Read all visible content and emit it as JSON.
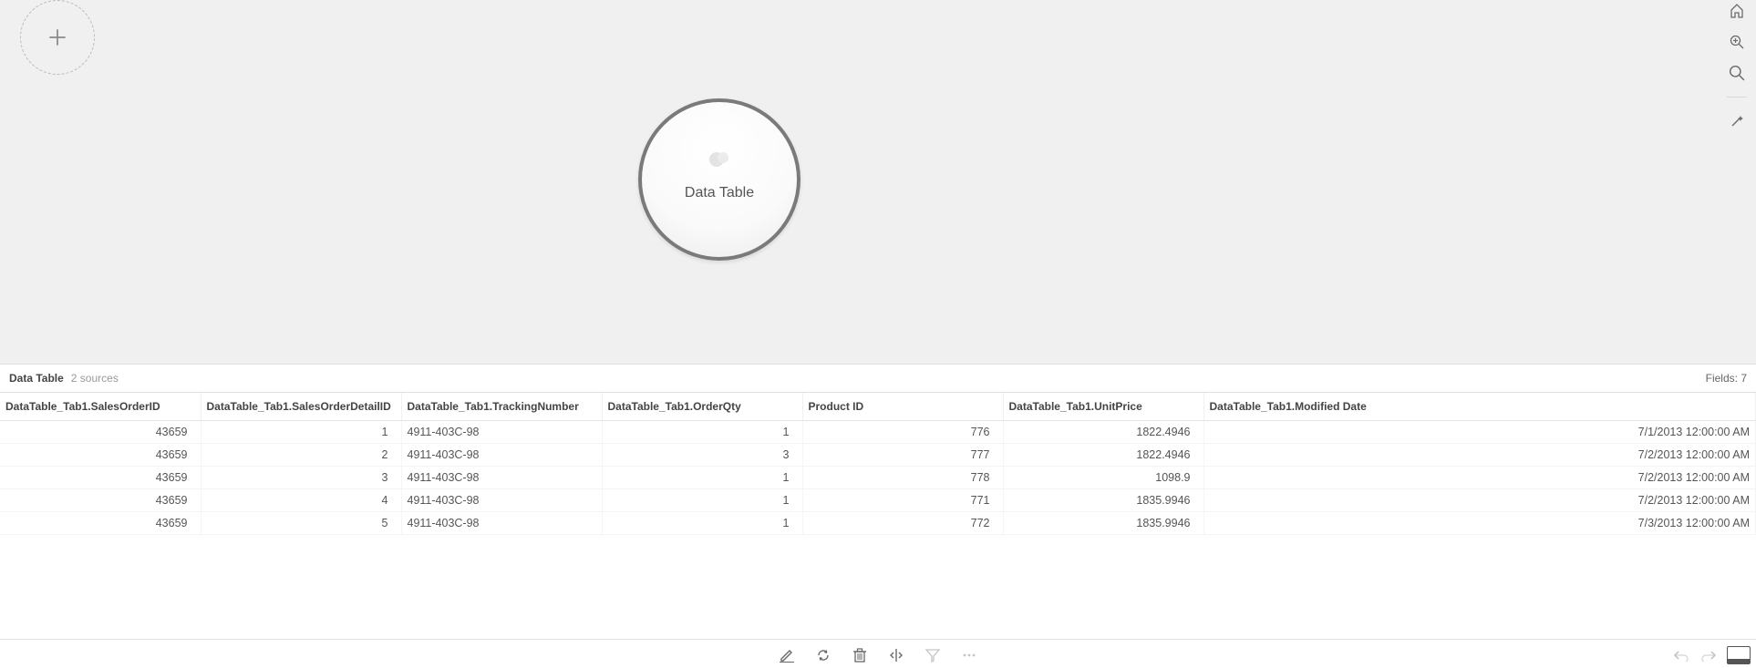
{
  "canvas": {
    "bubble_label": "Data Table"
  },
  "info": {
    "title": "Data Table",
    "sources": "2 sources",
    "fields": "Fields: 7"
  },
  "table": {
    "headers": [
      "DataTable_Tab1.SalesOrderID",
      "DataTable_Tab1.SalesOrderDetailID",
      "DataTable_Tab1.TrackingNumber",
      "DataTable_Tab1.OrderQty",
      "Product ID",
      "DataTable_Tab1.UnitPrice",
      "DataTable_Tab1.Modified Date"
    ],
    "rows": [
      {
        "sales_order_id": "43659",
        "detail_id": "1",
        "tracking": "4911-403C-98",
        "qty": "1",
        "product_id": "776",
        "unit_price": "1822.4946",
        "modified": "7/1/2013 12:00:00 AM"
      },
      {
        "sales_order_id": "43659",
        "detail_id": "2",
        "tracking": "4911-403C-98",
        "qty": "3",
        "product_id": "777",
        "unit_price": "1822.4946",
        "modified": "7/2/2013 12:00:00 AM"
      },
      {
        "sales_order_id": "43659",
        "detail_id": "3",
        "tracking": "4911-403C-98",
        "qty": "1",
        "product_id": "778",
        "unit_price": "1098.9",
        "modified": "7/2/2013 12:00:00 AM"
      },
      {
        "sales_order_id": "43659",
        "detail_id": "4",
        "tracking": "4911-403C-98",
        "qty": "1",
        "product_id": "771",
        "unit_price": "1835.9946",
        "modified": "7/2/2013 12:00:00 AM"
      },
      {
        "sales_order_id": "43659",
        "detail_id": "5",
        "tracking": "4911-403C-98",
        "qty": "1",
        "product_id": "772",
        "unit_price": "1835.9946",
        "modified": "7/3/2013 12:00:00 AM"
      }
    ]
  }
}
